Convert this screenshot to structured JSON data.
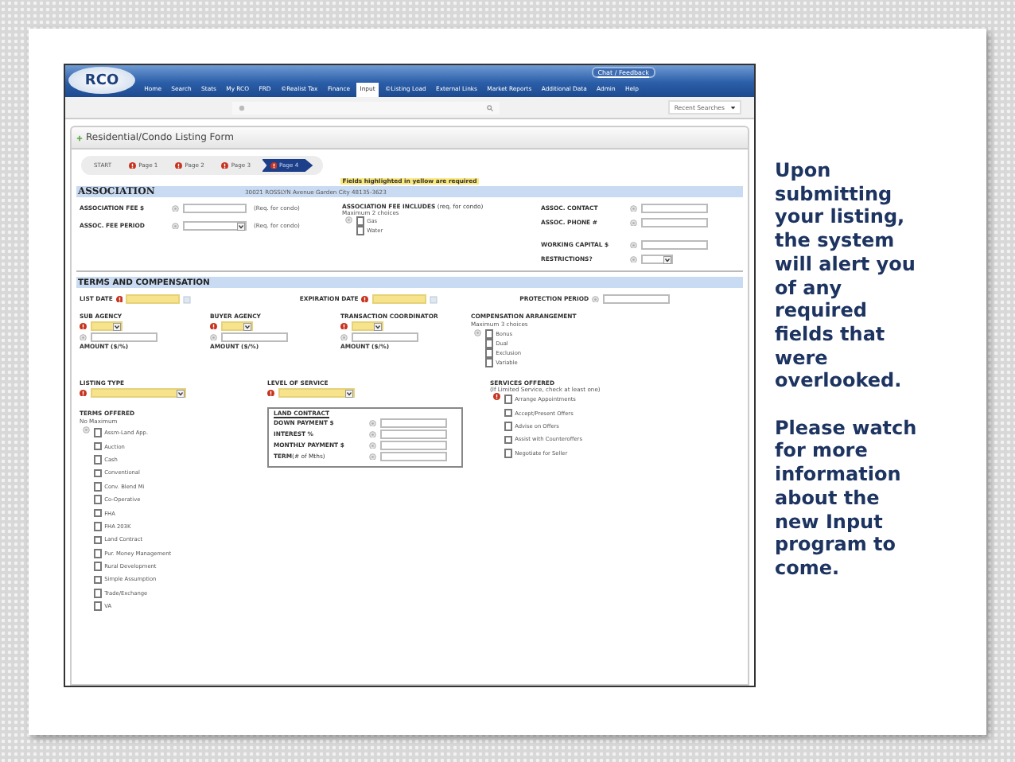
{
  "slide_text": [
    "Upon submitting your listing, the system will alert you of any required fields that were overlooked.",
    "Please watch for more information about the new Input program to come."
  ],
  "app": {
    "logo": "RCO",
    "feedback_link": "Chat / Feedback",
    "nav": [
      {
        "label": "Home",
        "selected": false
      },
      {
        "label": "Search",
        "selected": false
      },
      {
        "label": "Stats",
        "selected": false
      },
      {
        "label": "My RCO",
        "selected": false
      },
      {
        "label": "FRD",
        "selected": false
      },
      {
        "label": "©Realist Tax",
        "selected": false
      },
      {
        "label": "Finance",
        "selected": false
      },
      {
        "label": "Input",
        "selected": true
      },
      {
        "label": "©Listing Load",
        "selected": false
      },
      {
        "label": "External Links",
        "selected": false
      },
      {
        "label": "Market Reports",
        "selected": false
      },
      {
        "label": "Additional Data",
        "selected": false
      },
      {
        "label": "Admin",
        "selected": false
      },
      {
        "label": "Help",
        "selected": false
      }
    ],
    "recent_searches": "Recent Searches",
    "form_title": "Residential/Condo Listing Form",
    "steps": [
      {
        "label": "START",
        "alert": false,
        "selected": false
      },
      {
        "label": "Page 1",
        "alert": true,
        "selected": false
      },
      {
        "label": "Page 2",
        "alert": true,
        "selected": false
      },
      {
        "label": "Page 3",
        "alert": true,
        "selected": false
      },
      {
        "label": "Page 4",
        "alert": true,
        "selected": true
      }
    ],
    "required_note": "Fields highlighted in yellow are required",
    "association": {
      "title": "ASSOCIATION",
      "address": "30021 ROSSLYN Avenue Garden City 48135-3623",
      "left": [
        {
          "label": "ASSOCIATION FEE $",
          "kind": "text",
          "required": false,
          "note": "(Req. for condo)"
        },
        {
          "label": "ASSOC. FEE PERIOD",
          "kind": "select",
          "required": false,
          "note": "(Req. for condo)"
        }
      ],
      "includes": {
        "label": "ASSOCIATION FEE INCLUDES",
        "note": "(req. for condo)",
        "hint": "Maximum 2 choices",
        "options": [
          {
            "label": "Gas",
            "checked": false
          },
          {
            "label": "Water",
            "checked": false
          }
        ]
      },
      "right": [
        {
          "label": "ASSOC. CONTACT",
          "kind": "text",
          "required": false
        },
        {
          "label": "ASSOC. PHONE #",
          "kind": "text",
          "required": false
        },
        {
          "label": "WORKING CAPITAL $",
          "kind": "text",
          "required": false
        },
        {
          "label": "RESTRICTIONS?",
          "kind": "select",
          "required": false
        }
      ]
    },
    "terms": {
      "title": "TERMS AND COMPENSATION",
      "dates": [
        {
          "label": "LIST DATE",
          "kind": "date",
          "required": true
        },
        {
          "label": "EXPIRATION DATE",
          "kind": "date",
          "required": true
        },
        {
          "label": "PROTECTION PERIOD",
          "kind": "text",
          "required": false
        }
      ],
      "agencies": [
        {
          "label": "SUB AGENCY",
          "amount_label": "AMOUNT ($/%)",
          "required": true
        },
        {
          "label": "BUYER AGENCY",
          "amount_label": "AMOUNT ($/%)",
          "required": true
        },
        {
          "label": "TRANSACTION COORDINATOR",
          "amount_label": "AMOUNT ($/%)",
          "required": true
        }
      ],
      "compensation": {
        "label": "COMPENSATION ARRANGEMENT",
        "hint": "Maximum 3 choices",
        "options": [
          {
            "label": "Bonus",
            "checked": false
          },
          {
            "label": "Dual",
            "checked": false
          },
          {
            "label": "Exclusion",
            "checked": false
          },
          {
            "label": "Variable",
            "checked": false
          }
        ]
      },
      "listing_type": {
        "label": "LISTING TYPE",
        "required": true
      },
      "level_of_service": {
        "label": "LEVEL OF SERVICE",
        "required": true
      },
      "services": {
        "label": "SERVICES OFFERED",
        "hint": "(If Limited Service, check at least one)",
        "required": true,
        "options": [
          {
            "label": "Arrange Appointments",
            "checked": false
          },
          {
            "label": "Accept/Present Offers",
            "checked": false
          },
          {
            "label": "Advise on Offers",
            "checked": false
          },
          {
            "label": "Assist with Counteroffers",
            "checked": false
          },
          {
            "label": "Negotiate for Seller",
            "checked": false
          }
        ]
      },
      "terms_offered": {
        "label": "TERMS OFFERED",
        "hint": "No Maximum",
        "options": [
          {
            "label": "Assm-Land App.",
            "checked": false
          },
          {
            "label": "Auction",
            "checked": false
          },
          {
            "label": "Cash",
            "checked": false
          },
          {
            "label": "Conventional",
            "checked": false
          },
          {
            "label": "Conv. Blend Mi",
            "checked": false
          },
          {
            "label": "Co-Operative",
            "checked": false
          },
          {
            "label": "FHA",
            "checked": false
          },
          {
            "label": "FHA 203K",
            "checked": false
          },
          {
            "label": "Land Contract",
            "checked": false
          },
          {
            "label": "Pur. Money Management",
            "checked": false
          },
          {
            "label": "Rural Development",
            "checked": false
          },
          {
            "label": "Simple Assumption",
            "checked": false
          },
          {
            "label": "Trade/Exchange",
            "checked": false
          },
          {
            "label": "VA",
            "checked": false
          }
        ]
      },
      "land_contract": {
        "title": "LAND CONTRACT",
        "fields": [
          {
            "label": "DOWN PAYMENT $"
          },
          {
            "label": "INTEREST %"
          },
          {
            "label": "MONTHLY PAYMENT $"
          },
          {
            "label": "TERM",
            "note": "(# of Mths)"
          }
        ]
      }
    }
  }
}
